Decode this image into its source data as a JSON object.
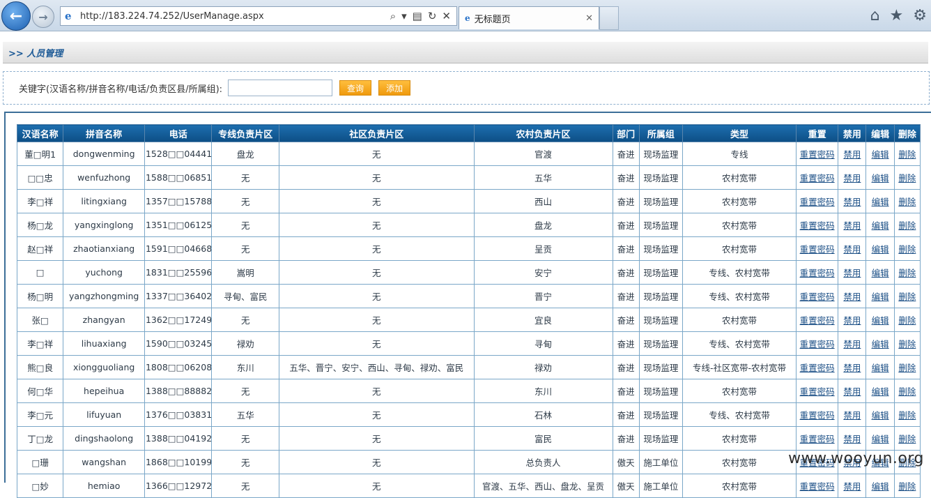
{
  "browser": {
    "url": "http://183.224.74.252/UserManage.aspx",
    "tab_title": "无标题页"
  },
  "page": {
    "title": ">> 人员管理"
  },
  "search": {
    "label": "关键字(汉语名称/拼音名称/电话/负责区县/所属组):",
    "value": "",
    "query_button": "查询",
    "add_button": "添加"
  },
  "table": {
    "headers": [
      "汉语名称",
      "拼音名称",
      "电话",
      "专线负责片区",
      "社区负责片区",
      "农村负责片区",
      "部门",
      "所属组",
      "类型",
      "重置",
      "禁用",
      "编辑",
      "删除"
    ],
    "action_labels": {
      "reset": "重置密码",
      "disable": "禁用",
      "edit": "编辑",
      "delete": "删除"
    },
    "rows": [
      {
        "name": "董□明1",
        "pinyin": "dongwenming",
        "phone": "1528□□04441",
        "special": "盘龙",
        "community": "无",
        "rural": "官渡",
        "dept": "奋进",
        "group": "现场监理",
        "type": "专线"
      },
      {
        "name": "□□忠",
        "pinyin": "wenfuzhong",
        "phone": "1588□□06851",
        "special": "无",
        "community": "无",
        "rural": "五华",
        "dept": "奋进",
        "group": "现场监理",
        "type": "农村宽带"
      },
      {
        "name": "李□祥",
        "pinyin": "litingxiang",
        "phone": "1357□□15788",
        "special": "无",
        "community": "无",
        "rural": "西山",
        "dept": "奋进",
        "group": "现场监理",
        "type": "农村宽带"
      },
      {
        "name": "杨□龙",
        "pinyin": "yangxinglong",
        "phone": "1351□□06125",
        "special": "无",
        "community": "无",
        "rural": "盘龙",
        "dept": "奋进",
        "group": "现场监理",
        "type": "农村宽带"
      },
      {
        "name": "赵□祥",
        "pinyin": "zhaotianxiang",
        "phone": "1591□□04668",
        "special": "无",
        "community": "无",
        "rural": "呈贡",
        "dept": "奋进",
        "group": "现场监理",
        "type": "农村宽带"
      },
      {
        "name": "□",
        "pinyin": "yuchong",
        "phone": "1831□□25596",
        "special": "嵩明",
        "community": "无",
        "rural": "安宁",
        "dept": "奋进",
        "group": "现场监理",
        "type": "专线、农村宽带"
      },
      {
        "name": "杨□明",
        "pinyin": "yangzhongming",
        "phone": "1337□□36402",
        "special": "寻甸、富民",
        "community": "无",
        "rural": "晋宁",
        "dept": "奋进",
        "group": "现场监理",
        "type": "专线、农村宽带"
      },
      {
        "name": "张□",
        "pinyin": "zhangyan",
        "phone": "1362□□17249",
        "special": "无",
        "community": "无",
        "rural": "宜良",
        "dept": "奋进",
        "group": "现场监理",
        "type": "农村宽带"
      },
      {
        "name": "李□祥",
        "pinyin": "lihuaxiang",
        "phone": "1590□□03245",
        "special": "禄劝",
        "community": "无",
        "rural": "寻甸",
        "dept": "奋进",
        "group": "现场监理",
        "type": "专线、农村宽带"
      },
      {
        "name": "熊□良",
        "pinyin": "xiongguoliang",
        "phone": "1808□□06208",
        "special": "东川",
        "community": "五华、晋宁、安宁、西山、寻甸、禄劝、富民",
        "rural": "禄劝",
        "dept": "奋进",
        "group": "现场监理",
        "type": "专线-社区宽带-农村宽带"
      },
      {
        "name": "何□华",
        "pinyin": "hepeihua",
        "phone": "1388□□88882",
        "special": "无",
        "community": "无",
        "rural": "东川",
        "dept": "奋进",
        "group": "现场监理",
        "type": "农村宽带"
      },
      {
        "name": "李□元",
        "pinyin": "lifuyuan",
        "phone": "1376□□03831",
        "special": "五华",
        "community": "无",
        "rural": "石林",
        "dept": "奋进",
        "group": "现场监理",
        "type": "专线、农村宽带"
      },
      {
        "name": "丁□龙",
        "pinyin": "dingshaolong",
        "phone": "1388□□04192",
        "special": "无",
        "community": "无",
        "rural": "富民",
        "dept": "奋进",
        "group": "现场监理",
        "type": "农村宽带"
      },
      {
        "name": "□珊",
        "pinyin": "wangshan",
        "phone": "1868□□10199",
        "special": "无",
        "community": "无",
        "rural": "总负责人",
        "dept": "傲天",
        "group": "施工单位",
        "type": "农村宽带"
      },
      {
        "name": "□妙",
        "pinyin": "hemiao",
        "phone": "1366□□12972",
        "special": "无",
        "community": "无",
        "rural": "官渡、五华、西山、盘龙、呈贡",
        "dept": "傲天",
        "group": "施工单位",
        "type": "农村宽带"
      }
    ]
  },
  "watermark": "www.wooyun.org"
}
